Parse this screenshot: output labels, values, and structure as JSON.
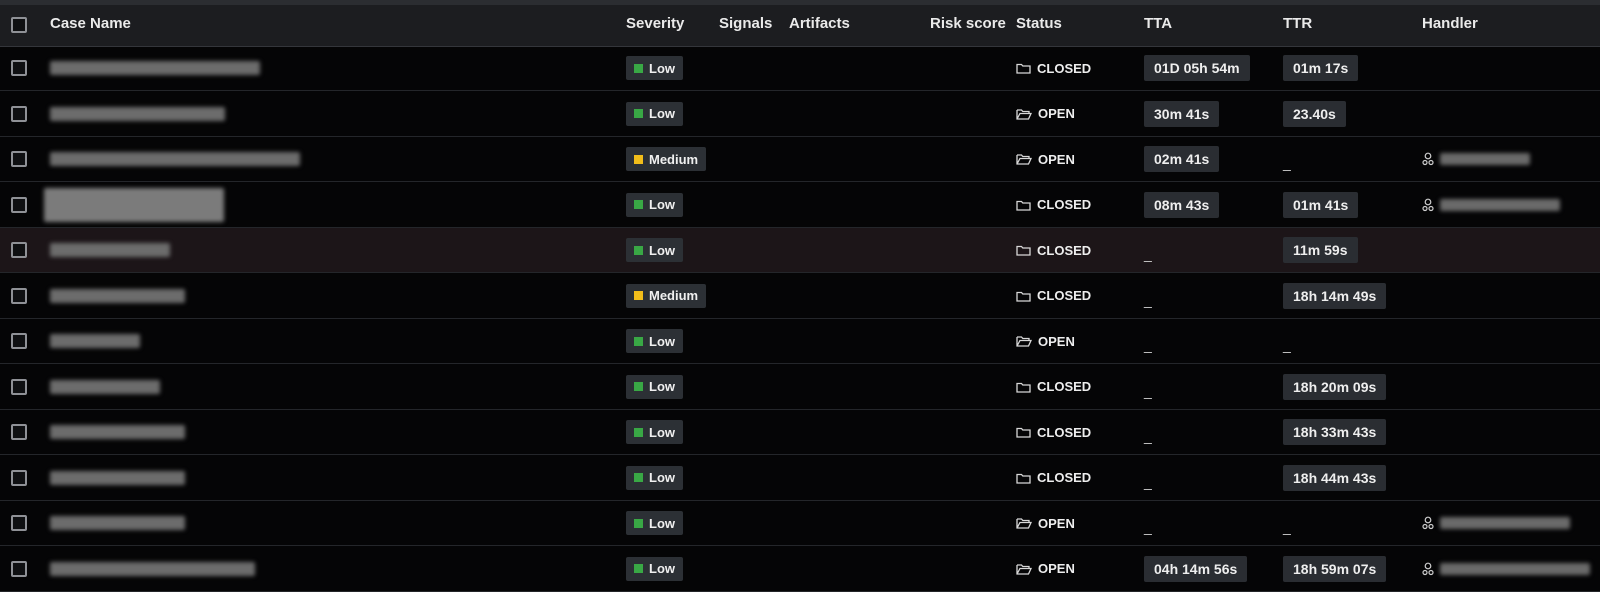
{
  "columns": {
    "case_name": "Case Name",
    "severity": "Severity",
    "signals": "Signals",
    "artifacts": "Artifacts",
    "risk_score": "Risk score",
    "status": "Status",
    "tta": "TTA",
    "ttr": "TTR",
    "handler": "Handler"
  },
  "colors": {
    "low": "#39a845",
    "medium": "#f2bd1a"
  },
  "rows": [
    {
      "severity": "Low",
      "status": "CLOSED",
      "tta": "01D 05h 54m",
      "ttr": "01m 17s",
      "handler": false
    },
    {
      "severity": "Low",
      "status": "OPEN",
      "tta": "30m 41s",
      "ttr": "23.40s",
      "handler": false
    },
    {
      "severity": "Medium",
      "status": "OPEN",
      "tta": "02m 41s",
      "ttr": "_",
      "handler": true
    },
    {
      "severity": "Low",
      "status": "CLOSED",
      "tta": "08m 43s",
      "ttr": "01m 41s",
      "handler": true
    },
    {
      "severity": "Low",
      "status": "CLOSED",
      "tta": "_",
      "ttr": "11m 59s",
      "handler": false
    },
    {
      "severity": "Medium",
      "status": "CLOSED",
      "tta": "_",
      "ttr": "18h 14m 49s",
      "handler": false
    },
    {
      "severity": "Low",
      "status": "OPEN",
      "tta": "_",
      "ttr": "_",
      "handler": false
    },
    {
      "severity": "Low",
      "status": "CLOSED",
      "tta": "_",
      "ttr": "18h 20m 09s",
      "handler": false
    },
    {
      "severity": "Low",
      "status": "CLOSED",
      "tta": "_",
      "ttr": "18h 33m 43s",
      "handler": false
    },
    {
      "severity": "Low",
      "status": "CLOSED",
      "tta": "_",
      "ttr": "18h 44m 43s",
      "handler": false
    },
    {
      "severity": "Low",
      "status": "OPEN",
      "tta": "_",
      "ttr": "_",
      "handler": true
    },
    {
      "severity": "Low",
      "status": "OPEN",
      "tta": "04h 14m 56s",
      "ttr": "18h 59m 07s",
      "handler": true
    }
  ]
}
